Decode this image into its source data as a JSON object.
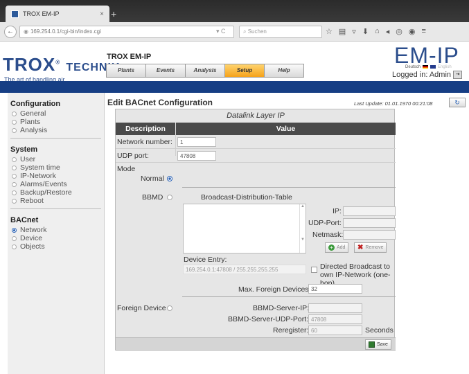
{
  "browser": {
    "tab_title": "TROX EM-IP",
    "tab_close": "×",
    "new_tab": "+",
    "back_glyph": "←",
    "url": "169.254.0.1/cgi-bin/index.cgi",
    "url_controls": "▾  C",
    "search_placeholder": "Suchen"
  },
  "header": {
    "brand": "TROX",
    "brand_suffix": "TECHNIK",
    "tagline": "The art of handling air",
    "app_title": "TROX EM-IP",
    "product": "EM-IP",
    "lang_de": "Deutsch",
    "lang_en": "English",
    "logged_in": "Logged in: Admin",
    "nav": [
      {
        "label": "Plants"
      },
      {
        "label": "Events"
      },
      {
        "label": "Analysis"
      },
      {
        "label": "Setup"
      },
      {
        "label": "Help"
      }
    ]
  },
  "sidebar": {
    "sections": [
      {
        "title": "Configuration",
        "items": [
          "General",
          "Plants",
          "Analysis"
        ]
      },
      {
        "title": "System",
        "items": [
          "User",
          "System time",
          "IP-Network",
          "Alarms/Events",
          "Backup/Restore",
          "Reboot"
        ]
      },
      {
        "title": "BACnet",
        "items": [
          "Network",
          "Device",
          "Objects"
        ]
      }
    ]
  },
  "main": {
    "title": "Edit BACnet Configuration",
    "last_update": "Last Update: 01.01.1970 00:21:08",
    "refresh_glyph": "↻",
    "datalink_title": "Datalink Layer IP",
    "col_description": "Description",
    "col_value": "Value",
    "network_number_label": "Network number:",
    "network_number_value": "1",
    "udp_port_label": "UDP port:",
    "udp_port_value": "47808",
    "mode_label": "Mode",
    "normal_label": "Normal",
    "bbmd_label": "BBMD",
    "bdt_title": "Broadcast-Distribution-Table",
    "ip_label": "IP:",
    "udp_port2_label": "UDP-Port:",
    "netmask_label": "Netmask:",
    "add_label": "Add",
    "remove_label": "Remove",
    "device_entry_label": "Device Entry:",
    "device_entry_value": "169.254.0.1:47808 / 255.255.255.255",
    "directed_broadcast_label": "Directed Broadcast to own IP-Network (one-hop)",
    "max_foreign_label": "Max. Foreign Devices:",
    "max_foreign_value": "32",
    "foreign_device_label": "Foreign Device",
    "bbmd_server_ip_label": "BBMD-Server-IP:",
    "bbmd_server_udp_label": "BBMD-Server-UDP-Port:",
    "bbmd_server_udp_value": "47808",
    "reregister_label": "Reregister:",
    "reregister_value": "60",
    "seconds_label": "Seconds",
    "save_label": "Save"
  },
  "colors": {
    "brand_blue": "#2b4d8c",
    "nav_bar": "#163e84",
    "active_tab": "#f5a21a",
    "table_header": "#4a4a4a"
  }
}
